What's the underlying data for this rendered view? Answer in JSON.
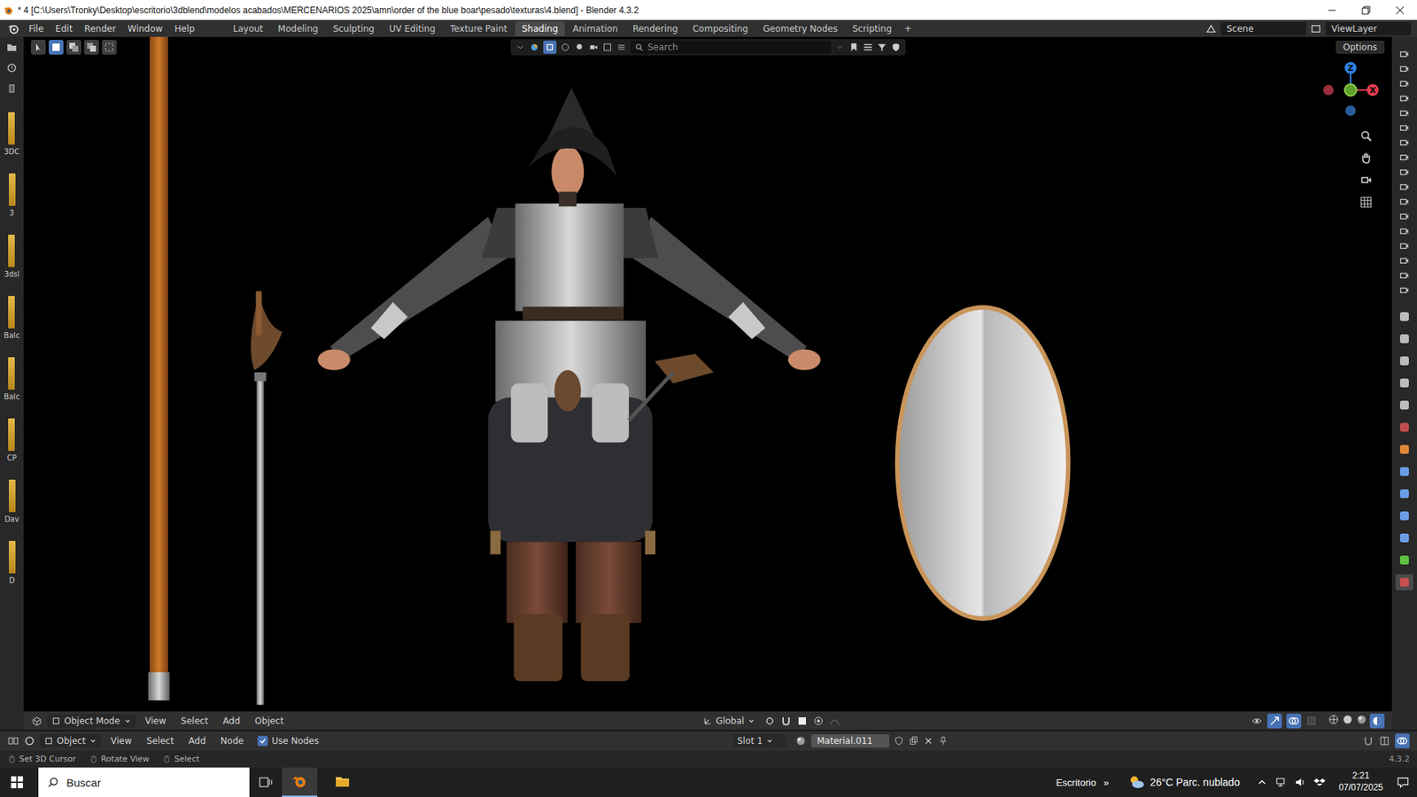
{
  "window": {
    "title": "* 4 [C:\\Users\\Tronky\\Desktop\\escritorio\\3dblend\\modelos acabados\\MERCENARIOS 2025\\amn\\order of the blue boar\\pesado\\texturas\\4.blend] - Blender 4.3.2"
  },
  "menu": [
    "File",
    "Edit",
    "Render",
    "Window",
    "Help"
  ],
  "workspaces": [
    {
      "label": "Layout",
      "selected": false
    },
    {
      "label": "Modeling",
      "selected": false
    },
    {
      "label": "Sculpting",
      "selected": false
    },
    {
      "label": "UV Editing",
      "selected": false
    },
    {
      "label": "Texture Paint",
      "selected": false
    },
    {
      "label": "Shading",
      "selected": true
    },
    {
      "label": "Animation",
      "selected": false
    },
    {
      "label": "Rendering",
      "selected": false
    },
    {
      "label": "Compositing",
      "selected": false
    },
    {
      "label": "Geometry Nodes",
      "selected": false
    },
    {
      "label": "Scripting",
      "selected": false
    }
  ],
  "add_workspace": "+",
  "scene": "Scene",
  "view_layer": "ViewLayer",
  "file_strip": [
    {
      "label": "3DC"
    },
    {
      "label": "3"
    },
    {
      "label": "3dsl"
    },
    {
      "label": "Balc"
    },
    {
      "label": "Balc"
    },
    {
      "label": "CP"
    },
    {
      "label": "Dav"
    },
    {
      "label": "D"
    }
  ],
  "viewport": {
    "search_placeholder": "Search",
    "options": "Options",
    "gizmo_axes": [
      {
        "label": "Z",
        "color": "#2f83e6"
      },
      {
        "label": "X",
        "color": "#e23c50"
      }
    ],
    "header": {
      "mode": "Object Mode",
      "menus": [
        "View",
        "Select",
        "Add",
        "Object"
      ],
      "orientation": "Global"
    }
  },
  "outliner_rows": [
    {
      "kind": "camera"
    },
    {
      "kind": "camera"
    },
    {
      "kind": "camera"
    },
    {
      "kind": "camera"
    },
    {
      "kind": "camera"
    },
    {
      "kind": "camera"
    },
    {
      "kind": "camera"
    },
    {
      "kind": "camera"
    },
    {
      "kind": "camera"
    },
    {
      "kind": "camera"
    },
    {
      "kind": "camera"
    },
    {
      "kind": "camera"
    },
    {
      "kind": "camera"
    },
    {
      "kind": "camera"
    },
    {
      "kind": "camera"
    },
    {
      "kind": "camera"
    },
    {
      "kind": "camera"
    }
  ],
  "properties_tabs": [
    {
      "color": "#bdbdbd",
      "selected": false
    },
    {
      "color": "#bdbdbd",
      "selected": false
    },
    {
      "color": "#bdbdbd",
      "selected": false
    },
    {
      "color": "#bdbdbd",
      "selected": false
    },
    {
      "color": "#bdbdbd",
      "selected": false
    },
    {
      "color": "#c14e4e",
      "selected": false
    },
    {
      "color": "#e0893a",
      "selected": false
    },
    {
      "color": "#6b9de6",
      "selected": false
    },
    {
      "color": "#6b9de6",
      "selected": false
    },
    {
      "color": "#6b9de6",
      "selected": false
    },
    {
      "color": "#6b9de6",
      "selected": false
    },
    {
      "color": "#60c040",
      "selected": false
    },
    {
      "color": "#c94f4f",
      "selected": true
    }
  ],
  "node_header": {
    "mode": "Object",
    "menus": [
      "View",
      "Select",
      "Add",
      "Node"
    ],
    "use_nodes": {
      "label": "Use Nodes",
      "checked": true
    },
    "slot": "Slot 1",
    "material": "Material.011"
  },
  "status_bar": {
    "hints": [
      "Set 3D Cursor",
      "Rotate View",
      "Select"
    ],
    "version": "4.3.2"
  },
  "taskbar": {
    "search": "Buscar",
    "desktop": "Escritorio",
    "chevron": "»",
    "weather": "26°C Parc. nublado",
    "time": "2:21",
    "date": "07/07/2025"
  }
}
